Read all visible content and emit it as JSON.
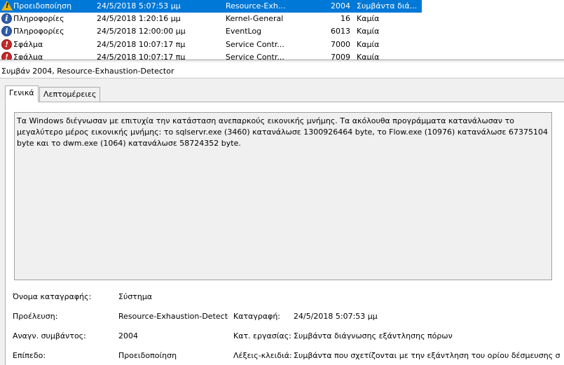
{
  "events": [
    {
      "level": "Προειδοποίηση",
      "level_icon": "warning-icon",
      "date": "24/5/2018 5:07:53 μμ",
      "source": "Resource-Exh...",
      "event_id": "2004",
      "task": "Συμβάντα διά...",
      "selected": true
    },
    {
      "level": "Πληροφορίες",
      "level_icon": "info-icon",
      "date": "24/5/2018 1:20:16 μμ",
      "source": "Kernel-General",
      "event_id": "16",
      "task": "Καμία",
      "selected": false
    },
    {
      "level": "Πληροφορίες",
      "level_icon": "info-icon",
      "date": "24/5/2018 12:00:00 μμ",
      "source": "EventLog",
      "event_id": "6013",
      "task": "Καμία",
      "selected": false
    },
    {
      "level": "Σφάλμα",
      "level_icon": "error-icon",
      "date": "24/5/2018 10:07:17 πμ",
      "source": "Service Contr...",
      "event_id": "7000",
      "task": "Καμία",
      "selected": false
    },
    {
      "level": "Σφάλμα",
      "level_icon": "error-icon",
      "date": "24/5/2018 10:07:17 πμ",
      "source": "Service Contr...",
      "event_id": "7009",
      "task": "Καμία",
      "selected": false
    }
  ],
  "details": {
    "title": "Συμβάν 2004, Resource-Exhaustion-Detector",
    "tabs": {
      "general": "Γενικά",
      "details": "Λεπτομέρειες"
    },
    "description": "Τα Windows διέγνωσαν με επιτυχία την κατάσταση ανεπαρκούς εικονικής μνήμης. Τα ακόλουθα προγράμματα κατανάλωσαν το μεγαλύτερο μέρος εικονικής μνήμης: το sqlservr.exe (3460) κατανάλωσε 1300926464 byte, το Flow.exe (10976) κατανάλωσε 67375104 byte και το dwm.exe (1064) κατανάλωσε 58724352 byte.",
    "fields": {
      "log_name_label": "Όνομα καταγραφής:",
      "log_name": "Σύστημα",
      "source_label": "Προέλευση:",
      "source": "Resource-Exhaustion-Detectc",
      "logged_label": "Καταγραφή:",
      "logged": "24/5/2018 5:07:53 μμ",
      "event_id_label": "Αναγν. συμβάντος:",
      "event_id": "2004",
      "task_label": "Κατ. εργασίας:",
      "task": "Συμβάντα διάγνωσης εξάντλησης πόρων",
      "level_label": "Επίπεδο:",
      "level": "Προειδοποίηση",
      "keywords_label": "Λέξεις-κλειδιά:",
      "keywords": "Συμβάντα που σχετίζονται με την εξάντληση του ορίου δέσμευσης συ"
    }
  },
  "colors": {
    "selection": "#0078d7",
    "panel_bg": "#f0f0f0"
  }
}
